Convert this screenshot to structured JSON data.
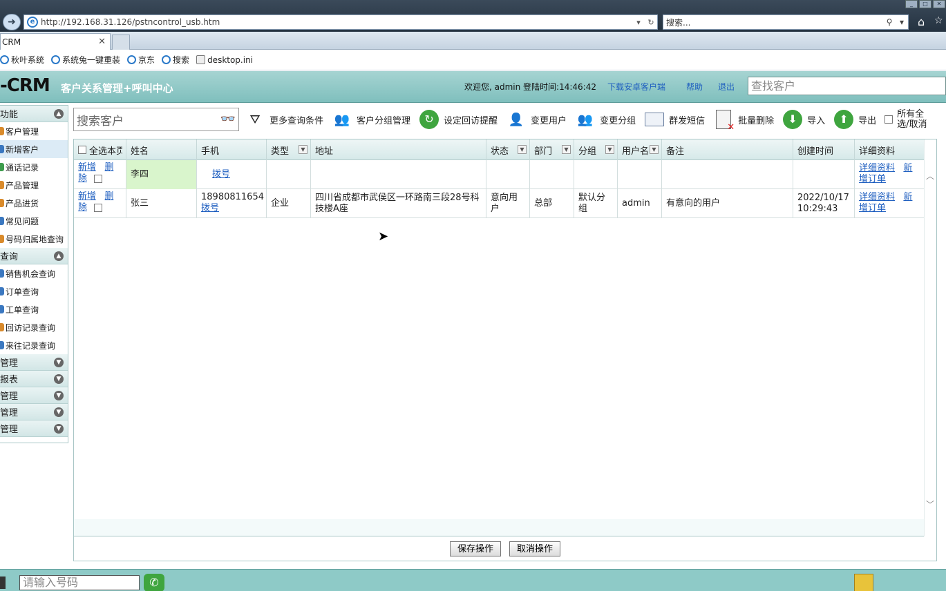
{
  "browser": {
    "url": "http://192.168.31.126/pstncontrol_usb.htm",
    "search_placeholder": "搜索...",
    "tab_title": "CRM",
    "favorites": [
      "秋叶系统",
      "系统兔一键重装",
      "京东",
      "搜索",
      "desktop.ini"
    ]
  },
  "header": {
    "logo": "-CRM",
    "subtitle": "客户关系管理+呼叫中心",
    "welcome": "欢迎您, admin 登陆时间:14:46:42",
    "download_link": "下载安卓客户端",
    "help_link": "帮助",
    "logout_link": "退出",
    "find_placeholder": "查找客户"
  },
  "sidebar": {
    "groups": [
      {
        "label": "功能",
        "expanded": true,
        "items": [
          "客户管理",
          "新增客户",
          "通话记录",
          "产品管理",
          "产品进货",
          "常见问题",
          "号码归属地查询"
        ]
      },
      {
        "label": "查询",
        "expanded": true,
        "items": [
          "销售机会查询",
          "订单查询",
          "工单查询",
          "回访记录查询",
          "来往记录查询"
        ]
      },
      {
        "label": "管理",
        "expanded": false,
        "items": []
      },
      {
        "label": "报表",
        "expanded": false,
        "items": []
      },
      {
        "label": "管理",
        "expanded": false,
        "items": []
      },
      {
        "label": "管理",
        "expanded": false,
        "items": []
      },
      {
        "label": "管理",
        "expanded": false,
        "items": []
      }
    ],
    "selected": "新增客户"
  },
  "toolbar": {
    "search_placeholder": "搜索客户",
    "more_query": "更多查询条件",
    "group_manage": "客户分组管理",
    "set_reminder": "设定回访提醒",
    "change_user": "变更用户",
    "change_group": "变更分组",
    "send_sms": "群发短信",
    "batch_delete": "批量删除",
    "import": "导入",
    "export": "导出",
    "select_all": "所有全选/取消"
  },
  "grid": {
    "select_all_page": "全选本页",
    "columns": [
      "姓名",
      "手机",
      "类型",
      "地址",
      "状态",
      "部门",
      "分组",
      "用户名",
      "备注",
      "创建时间",
      "详细资料"
    ],
    "op_add": "新增",
    "op_delete": "删除",
    "dial": "拨号",
    "detail": "详细资料",
    "add_order": "新增订单",
    "rows": [
      {
        "name": "李四",
        "phone": "",
        "type": "",
        "address": "",
        "status": "",
        "dept": "",
        "group": "",
        "user": "",
        "note": "",
        "created": ""
      },
      {
        "name": "张三",
        "phone": "18980811654",
        "type": "企业",
        "address": "四川省成都市武侯区一环路南三段28号科技楼A座",
        "status": "意向用户",
        "dept": "总部",
        "group": "默认分组",
        "user": "admin",
        "note": "有意向的用户",
        "created": "2022/10/17 10:29:43"
      }
    ]
  },
  "actions": {
    "save": "保存操作",
    "cancel": "取消操作"
  },
  "phone": {
    "placeholder": "请输入号码"
  }
}
